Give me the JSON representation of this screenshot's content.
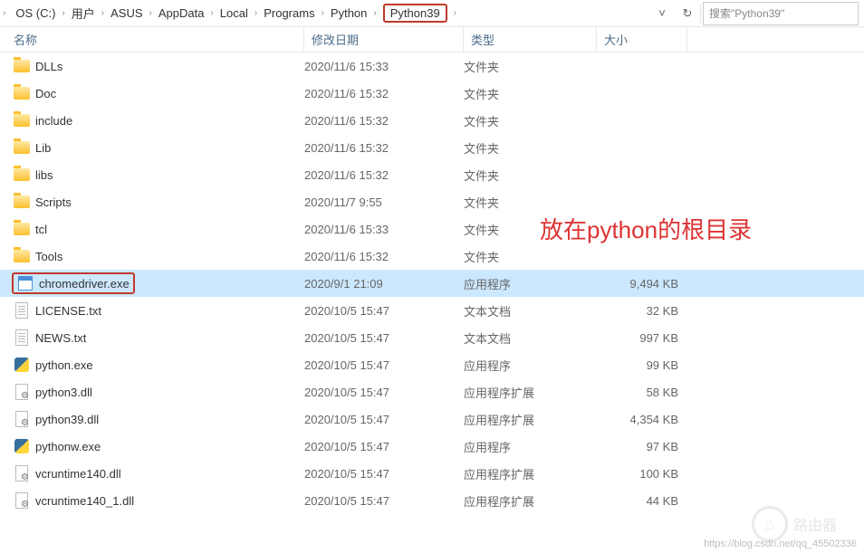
{
  "breadcrumb": [
    "OS (C:)",
    "用户",
    "ASUS",
    "AppData",
    "Local",
    "Programs",
    "Python",
    "Python39"
  ],
  "search_placeholder": "搜索\"Python39\"",
  "columns": {
    "name": "名称",
    "date": "修改日期",
    "type": "类型",
    "size": "大小"
  },
  "annotation": "放在python的根目录",
  "files": [
    {
      "icon": "folder",
      "name": "DLLs",
      "date": "2020/11/6 15:33",
      "type": "文件夹",
      "size": ""
    },
    {
      "icon": "folder",
      "name": "Doc",
      "date": "2020/11/6 15:32",
      "type": "文件夹",
      "size": ""
    },
    {
      "icon": "folder",
      "name": "include",
      "date": "2020/11/6 15:32",
      "type": "文件夹",
      "size": ""
    },
    {
      "icon": "folder",
      "name": "Lib",
      "date": "2020/11/6 15:32",
      "type": "文件夹",
      "size": ""
    },
    {
      "icon": "folder",
      "name": "libs",
      "date": "2020/11/6 15:32",
      "type": "文件夹",
      "size": ""
    },
    {
      "icon": "folder",
      "name": "Scripts",
      "date": "2020/11/7 9:55",
      "type": "文件夹",
      "size": ""
    },
    {
      "icon": "folder",
      "name": "tcl",
      "date": "2020/11/6 15:33",
      "type": "文件夹",
      "size": ""
    },
    {
      "icon": "folder",
      "name": "Tools",
      "date": "2020/11/6 15:32",
      "type": "文件夹",
      "size": ""
    },
    {
      "icon": "exe",
      "name": "chromedriver.exe",
      "date": "2020/9/1 21:09",
      "type": "应用程序",
      "size": "9,494 KB",
      "selected": true
    },
    {
      "icon": "txt",
      "name": "LICENSE.txt",
      "date": "2020/10/5 15:47",
      "type": "文本文档",
      "size": "32 KB"
    },
    {
      "icon": "txt",
      "name": "NEWS.txt",
      "date": "2020/10/5 15:47",
      "type": "文本文档",
      "size": "997 KB"
    },
    {
      "icon": "py",
      "name": "python.exe",
      "date": "2020/10/5 15:47",
      "type": "应用程序",
      "size": "99 KB"
    },
    {
      "icon": "dll",
      "name": "python3.dll",
      "date": "2020/10/5 15:47",
      "type": "应用程序扩展",
      "size": "58 KB"
    },
    {
      "icon": "dll",
      "name": "python39.dll",
      "date": "2020/10/5 15:47",
      "type": "应用程序扩展",
      "size": "4,354 KB"
    },
    {
      "icon": "py",
      "name": "pythonw.exe",
      "date": "2020/10/5 15:47",
      "type": "应用程序",
      "size": "97 KB"
    },
    {
      "icon": "dll",
      "name": "vcruntime140.dll",
      "date": "2020/10/5 15:47",
      "type": "应用程序扩展",
      "size": "100 KB"
    },
    {
      "icon": "dll",
      "name": "vcruntime140_1.dll",
      "date": "2020/10/5 15:47",
      "type": "应用程序扩展",
      "size": "44 KB"
    }
  ],
  "watermark_url": "https://blog.csdn.net/qq_45502336",
  "watermark_text": "路由器"
}
